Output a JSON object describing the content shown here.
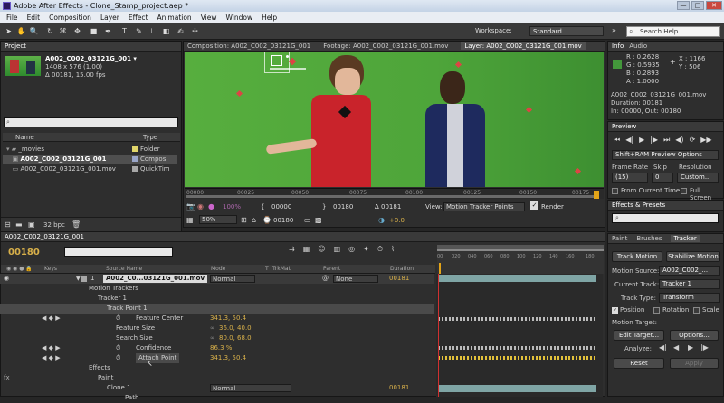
{
  "window": {
    "title": "Adobe After Effects - Clone_Stamp_project.aep *",
    "btn_min": "—",
    "btn_max": "□",
    "btn_close": "✕"
  },
  "menu": [
    "File",
    "Edit",
    "Composition",
    "Layer",
    "Effect",
    "Animation",
    "View",
    "Window",
    "Help"
  ],
  "toolbar": {
    "workspace_label": "Workspace:",
    "workspace_value": "Standard",
    "search_placeholder": "Search Help"
  },
  "project": {
    "tab": "Project",
    "comp_name": "A002_C002_03121G_001 ▾",
    "comp_size": "1408 x 576 (1.00)",
    "comp_duration": "Δ 00181, 15.00 fps",
    "search_icon": "⌕",
    "col_name": "Name",
    "col_type": "Type",
    "items": [
      {
        "name": "_movies",
        "type": "Folder",
        "color": "#e0d56a"
      },
      {
        "name": "A002_C002_03121G_001",
        "type": "Composi",
        "color": "#9aa6c9"
      },
      {
        "name": "A002_C002_03121G_001.mov",
        "type": "QuickTim",
        "color": "#a7a7a7"
      }
    ],
    "bpc": "32 bpc"
  },
  "viewer": {
    "tabs": [
      "Composition: A002_C002_03121G_001",
      "Footage: A002_C002_03121G_001.mov",
      "Layer: A002_C002_03121G_001.mov"
    ],
    "ruler": [
      "00000",
      "00025",
      "00050",
      "00075",
      "00100",
      "00125",
      "00150",
      "00175"
    ],
    "zoom": "50%",
    "frame": "00180",
    "in_point": "00000",
    "out_point": "00180",
    "duration": "Δ 00181",
    "exposure": "+0.0",
    "view_label": "View:",
    "view_value": "Motion Tracker Points",
    "render_label": "Render"
  },
  "info": {
    "tabs": [
      "Info",
      "Audio"
    ],
    "r": "R : 0.2628",
    "g": "G : 0.5935",
    "b": "B : 0.2893",
    "a": "A : 1.0000",
    "x": "X : 1166",
    "y": "Y : 506",
    "file": "A002_C002_03121G_001.mov",
    "duration": "Duration: 00181",
    "inout": "In: 00000, Out: 00180"
  },
  "preview": {
    "tab": "Preview",
    "mode": "Shift+RAM Preview Options",
    "frame_rate_label": "Frame Rate",
    "skip_label": "Skip",
    "resolution_label": "Resolution",
    "frame_rate": "(15)",
    "skip": "0",
    "resolution": "Custom...",
    "from_current": "From Current Time",
    "full_screen": "Full Screen"
  },
  "effects": {
    "tab": "Effects & Presets",
    "search_placeholder": "⌕"
  },
  "tracker": {
    "tabs": [
      "Paint",
      "Brushes",
      "Tracker"
    ],
    "track_motion": "Track Motion",
    "stabilize_motion": "Stabilize Motion",
    "motion_source_label": "Motion Source:",
    "motion_source": "A002_C002_...",
    "current_track_label": "Current Track:",
    "current_track": "Tracker 1",
    "track_type_label": "Track Type:",
    "track_type": "Transform",
    "position": "Position",
    "rotation": "Rotation",
    "scale": "Scale",
    "motion_target_label": "Motion Target:",
    "edit_target": "Edit Target...",
    "options": "Options...",
    "analyze_label": "Analyze:",
    "reset": "Reset",
    "apply": "Apply"
  },
  "timeline": {
    "tab": "A002_C002_03121G_001",
    "timecode": "00180",
    "col_keys": "Keys",
    "col_source": "Source Name",
    "col_mode": "Mode",
    "col_t": "T",
    "col_trkmat": "TrkMat",
    "col_parent": "Parent",
    "col_duration": "Duration",
    "ruler": [
      "00",
      "020",
      "040",
      "060",
      "080",
      "100",
      "120",
      "140",
      "160",
      "180"
    ],
    "rows": [
      {
        "indent": 0,
        "text": "1",
        "name": "A002_C0...03121G_001.mov",
        "mode": "Normal",
        "parent": "None",
        "dur": "00181"
      },
      {
        "indent": 1,
        "text": "Motion Trackers"
      },
      {
        "indent": 2,
        "text": "Tracker 1"
      },
      {
        "indent": 3,
        "text": "Track Point 1"
      },
      {
        "indent": 4,
        "text": "Feature Center",
        "val": "341.3, 50.4"
      },
      {
        "indent": 4,
        "text": "Feature Size",
        "val": "36.0, 40.0"
      },
      {
        "indent": 4,
        "text": "Search Size",
        "val": "80.0, 68.0"
      },
      {
        "indent": 4,
        "text": "Confidence",
        "val": "86.3 %"
      },
      {
        "indent": 4,
        "text": "Attach Point",
        "val": "341.3, 50.4"
      },
      {
        "indent": 1,
        "text": "Effects"
      },
      {
        "indent": 2,
        "text": "Paint"
      },
      {
        "indent": 3,
        "text": "Clone 1",
        "mode": "Normal",
        "dur": "00181"
      },
      {
        "indent": 4,
        "text": "Path"
      }
    ]
  }
}
